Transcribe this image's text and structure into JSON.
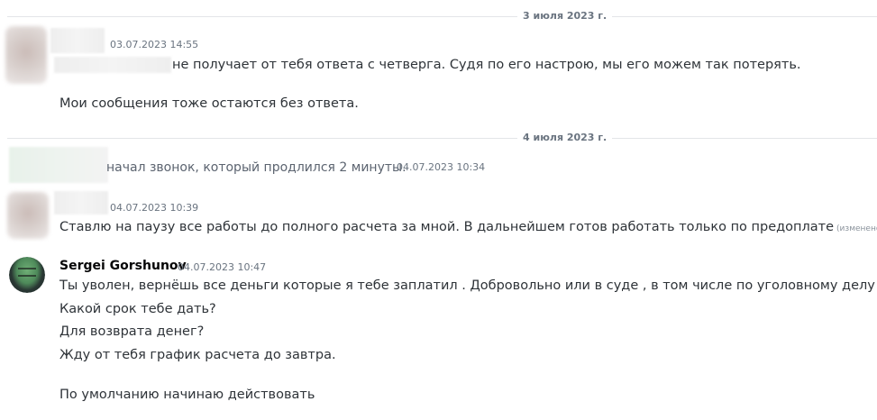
{
  "dividers": [
    {
      "label": "3 июля 2023 г."
    },
    {
      "label": "4 июля 2023 г."
    }
  ],
  "messages": {
    "m1": {
      "timestamp": "03.07.2023 14:55",
      "line1": "не получает от тебя ответа с четверга. Судя по его настрою, мы его можем так потерять.",
      "line2": "Мои сообщения тоже остаются без ответа."
    },
    "call": {
      "text": "начал звонок, который продлился 2 минуты.",
      "timestamp": "04.07.2023 10:34"
    },
    "m2": {
      "timestamp": "04.07.2023 10:39",
      "text": "Ставлю на паузу все работы до полного расчета за мной. В дальнейшем готов работать только по предоплате",
      "edited": "(изменено)"
    },
    "m3": {
      "username": "Sergei Gorshunov",
      "timestamp": "04.07.2023 10:47",
      "lines": [
        "Ты уволен, вернёшь все деньги которые я тебе заплатил . Добровольно или в суде , в том числе по уголовному делу",
        "Какой срок тебе дать?",
        "Для возврата денег?",
        "Жду от тебя график расчета до завтра.",
        "По умолчанию начинаю действовать"
      ]
    }
  }
}
